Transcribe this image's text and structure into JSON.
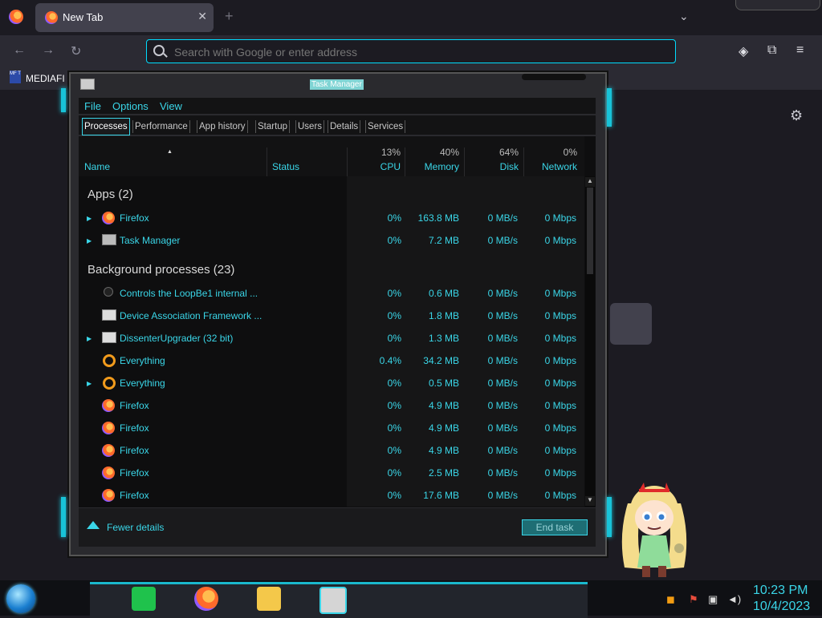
{
  "browser": {
    "tab_title": "New Tab",
    "tab_close": "✕",
    "new_tab": "+",
    "tab_list": "⌄",
    "search_placeholder": "Search with Google or enter address",
    "bookmark_label": "MEDIAFI",
    "bookmark_icon_text": "MF T",
    "back": "←",
    "forward": "→",
    "reload": "↻",
    "settings_icon": "⚙",
    "pocket_icon": "◈",
    "extensions_icon": "⧉",
    "menu_icon": "≡"
  },
  "task_manager": {
    "title": "Task Manager",
    "menu": [
      "File",
      "Options",
      "View"
    ],
    "tabs": [
      "Processes",
      "Performance",
      "App history",
      "Startup",
      "Users",
      "Details",
      "Services"
    ],
    "columns": {
      "name": "Name",
      "status": "Status",
      "cpu_pct": "13%",
      "cpu": "CPU",
      "memory_pct": "40%",
      "memory": "Memory",
      "disk_pct": "64%",
      "disk": "Disk",
      "network_pct": "0%",
      "network": "Network"
    },
    "apps_group": "Apps (2)",
    "apps": [
      {
        "name": "Firefox",
        "cpu": "0%",
        "memory": "163.8 MB",
        "disk": "0 MB/s",
        "network": "0 Mbps",
        "icon": "firefox-icon",
        "expandable": true
      },
      {
        "name": "Task Manager",
        "cpu": "0%",
        "memory": "7.2 MB",
        "disk": "0 MB/s",
        "network": "0 Mbps",
        "icon": "task-manager-icon",
        "expandable": true
      }
    ],
    "bg_group": "Background processes (23)",
    "background": [
      {
        "name": "Controls the LoopBe1 internal ...",
        "cpu": "0%",
        "memory": "0.6 MB",
        "disk": "0 MB/s",
        "network": "0 Mbps",
        "icon": "loopbe-icon",
        "expandable": false
      },
      {
        "name": "Device Association Framework ...",
        "cpu": "0%",
        "memory": "1.8 MB",
        "disk": "0 MB/s",
        "network": "0 Mbps",
        "icon": "window-icon",
        "expandable": false
      },
      {
        "name": "DissenterUpgrader (32 bit)",
        "cpu": "0%",
        "memory": "1.3 MB",
        "disk": "0 MB/s",
        "network": "0 Mbps",
        "icon": "window-icon",
        "expandable": true
      },
      {
        "name": "Everything",
        "cpu": "0.4%",
        "memory": "34.2 MB",
        "disk": "0 MB/s",
        "network": "0 Mbps",
        "icon": "magnifier-icon",
        "expandable": false
      },
      {
        "name": "Everything",
        "cpu": "0%",
        "memory": "0.5 MB",
        "disk": "0 MB/s",
        "network": "0 Mbps",
        "icon": "magnifier-icon",
        "expandable": true
      },
      {
        "name": "Firefox",
        "cpu": "0%",
        "memory": "4.9 MB",
        "disk": "0 MB/s",
        "network": "0 Mbps",
        "icon": "firefox-icon",
        "expandable": false
      },
      {
        "name": "Firefox",
        "cpu": "0%",
        "memory": "4.9 MB",
        "disk": "0 MB/s",
        "network": "0 Mbps",
        "icon": "firefox-icon",
        "expandable": false
      },
      {
        "name": "Firefox",
        "cpu": "0%",
        "memory": "4.9 MB",
        "disk": "0 MB/s",
        "network": "0 Mbps",
        "icon": "firefox-icon",
        "expandable": false
      },
      {
        "name": "Firefox",
        "cpu": "0%",
        "memory": "2.5 MB",
        "disk": "0 MB/s",
        "network": "0 Mbps",
        "icon": "firefox-icon",
        "expandable": false
      },
      {
        "name": "Firefox",
        "cpu": "0%",
        "memory": "17.6 MB",
        "disk": "0 MB/s",
        "network": "0 Mbps",
        "icon": "firefox-icon",
        "expandable": false
      }
    ],
    "fewer_details": "Fewer details",
    "end_task": "End task"
  },
  "taskbar": {
    "time": "10:23 PM",
    "date": "10/4/2023",
    "apps": [
      "notes-icon",
      "firefox-icon",
      "file-explorer-icon",
      "task-manager-icon"
    ]
  },
  "colors": {
    "accent": "#3ad6e8",
    "background": "#1c1b22"
  }
}
